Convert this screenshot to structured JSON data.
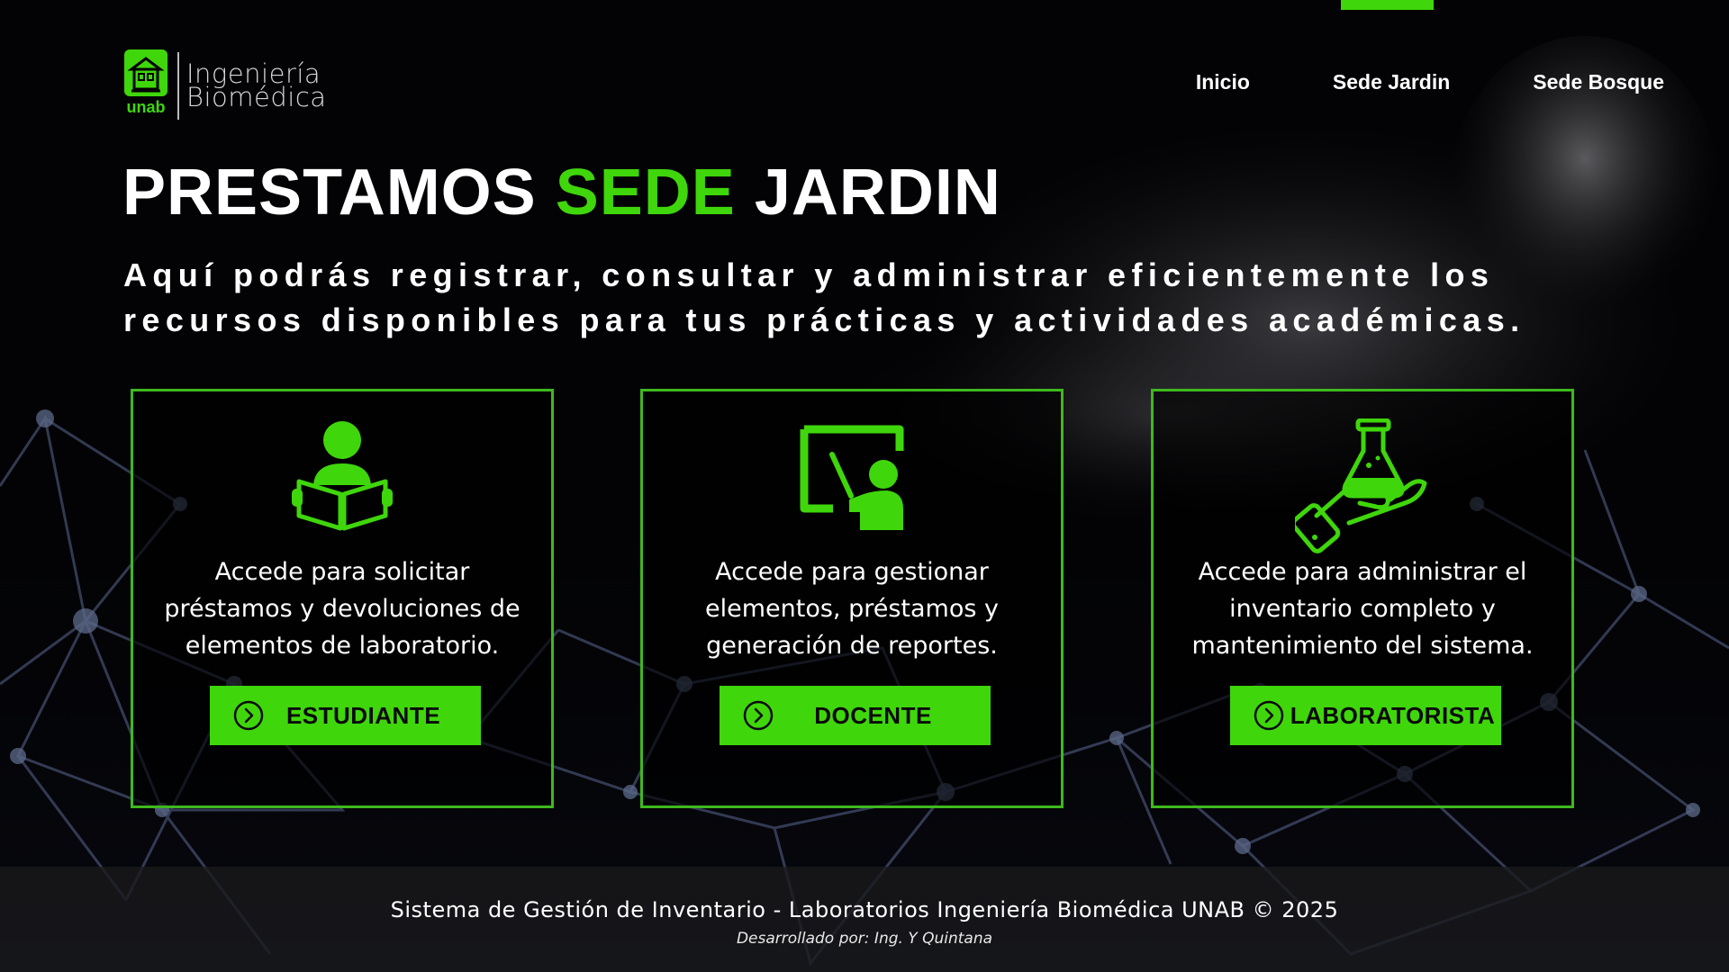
{
  "brand": {
    "logo_small": "unab",
    "line1": "Ingeniería",
    "line2": "Biomédica",
    "accent_color": "#3fd60b"
  },
  "nav": {
    "items": [
      {
        "label": "Inicio",
        "icon": null
      },
      {
        "label": "Sede Jardin",
        "icon": null
      },
      {
        "label": "Sede Bosque",
        "icon": null
      }
    ]
  },
  "hero": {
    "title_part1": "PRESTAMOS",
    "title_part2": "SEDE",
    "title_part3": "JARDIN",
    "subtitle": "Aquí podrás registrar, consultar y administrar eficientemente los recursos disponibles para tus prácticas y actividades académicas."
  },
  "cards": [
    {
      "icon": "student-reading-icon",
      "description": "Accede para solicitar préstamos y devoluciones de elementos de laboratorio.",
      "button": "ESTUDIANTE"
    },
    {
      "icon": "teacher-board-icon",
      "description": "Accede para gestionar elementos, préstamos y generación de reportes.",
      "button": "DOCENTE"
    },
    {
      "icon": "flask-hand-icon",
      "description": "Accede para administrar el inventario completo y mantenimiento del sistema.",
      "button": "LABORATORISTA"
    }
  ],
  "footer": {
    "line1": "Sistema de Gestión de Inventario - Laboratorios Ingeniería Biomédica UNAB © 2025",
    "line2": "Desarrollado por: Ing. Y Quintana"
  }
}
